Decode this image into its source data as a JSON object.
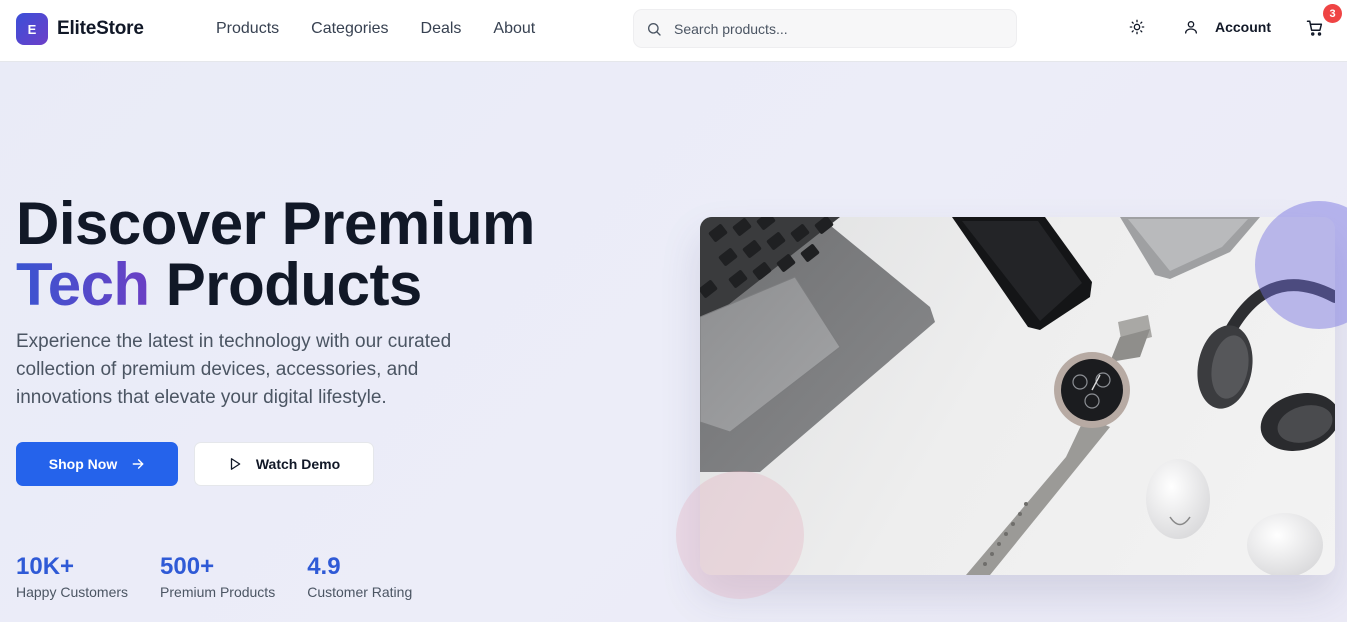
{
  "header": {
    "logo_letter": "E",
    "brand": "EliteStore",
    "nav": [
      "Products",
      "Categories",
      "Deals",
      "About"
    ],
    "search_placeholder": "Search products...",
    "account_label": "Account",
    "cart_count": "3"
  },
  "hero": {
    "title_line1": "Discover Premium",
    "title_accent": "Tech",
    "title_line2_rest": " Products",
    "subtitle": "Experience the latest in technology with our curated collection of premium devices, accessories, and innovations that elevate your digital lifestyle.",
    "primary_button": "Shop Now",
    "secondary_button": "Watch Demo",
    "stats": [
      {
        "value": "10K+",
        "label": "Happy Customers"
      },
      {
        "value": "500+",
        "label": "Premium Products"
      },
      {
        "value": "4.9",
        "label": "Customer Rating"
      }
    ]
  },
  "icons": {
    "search": "search-icon",
    "theme": "sun-icon",
    "account": "user-icon",
    "cart": "cart-icon",
    "arrow": "arrow-right-icon",
    "play": "play-icon"
  },
  "colors": {
    "primary": "#2563eb",
    "accent_gradient_start": "#3a55d1",
    "accent_gradient_end": "#6b3fc4",
    "badge": "#ef4444",
    "stat_number": "#2f5ad6"
  }
}
